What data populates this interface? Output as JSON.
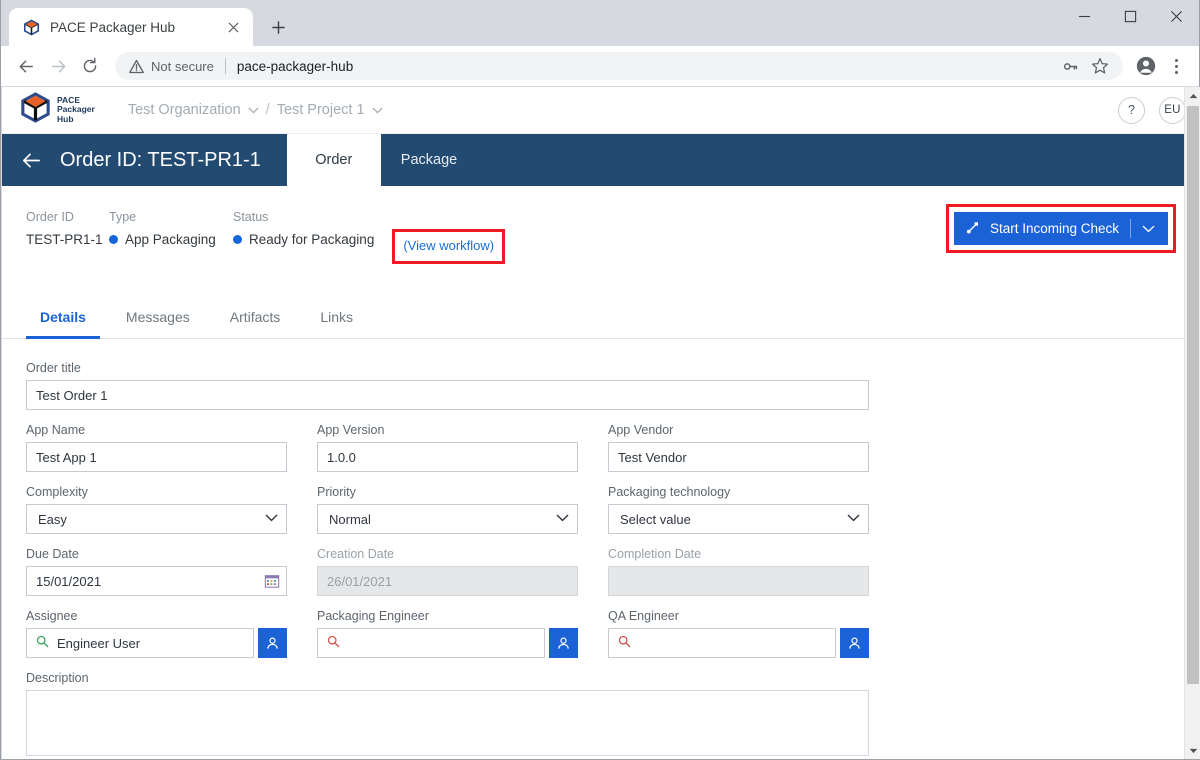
{
  "browser": {
    "tab": {
      "title": "PACE Packager Hub",
      "favicon_icon": "pace-cube-icon",
      "close_icon": "close-icon"
    },
    "new_tab_label": "+",
    "nav": {
      "back_icon": "back-arrow-icon",
      "forward_icon": "forward-arrow-icon",
      "reload_icon": "reload-icon"
    },
    "omnibox": {
      "security_icon": "not-secure-warning-icon",
      "security_label": "Not secure",
      "url": "pace-packager-hub",
      "key_icon": "password-key-icon",
      "star_icon": "bookmark-star-icon",
      "profile_icon": "profile-avatar-icon",
      "menu_icon": "kebab-menu-icon"
    },
    "window": {
      "minimize": "—",
      "maximize": "□",
      "close": "✕"
    }
  },
  "appbar": {
    "logo": {
      "icon": "pace-cube-logo-icon",
      "line1": "PACE",
      "line2": "Packager",
      "line3": "Hub"
    },
    "breadcrumbs": [
      {
        "label": "Test Organization",
        "caret": "⌄"
      },
      {
        "label": "Test Project 1",
        "caret": "⌄"
      }
    ],
    "separator": "/",
    "help_label": "?",
    "avatar_label": "EU"
  },
  "orderbar": {
    "back_icon": "back-arrow-icon",
    "title": "Order ID: TEST-PR1-1",
    "tabs": [
      {
        "label": "Order",
        "active": true
      },
      {
        "label": "Package",
        "active": false
      }
    ]
  },
  "meta": {
    "fields": [
      {
        "label": "Order ID",
        "value": "TEST-PR1-1",
        "has_dot": false
      },
      {
        "label": "Type",
        "value": "App Packaging",
        "has_dot": true
      },
      {
        "label": "Status",
        "value": "Ready for Packaging",
        "has_dot": true
      }
    ],
    "view_workflow_label": "(View workflow)",
    "dot_color": "#1565d8",
    "highlight_color": "#ee1b24"
  },
  "action": {
    "icon": "workflow-branch-icon",
    "label": "Start Incoming Check",
    "caret": "⌄",
    "color": "#1b62d6"
  },
  "subtabs": [
    {
      "label": "Details",
      "active": true
    },
    {
      "label": "Messages",
      "active": false
    },
    {
      "label": "Artifacts",
      "active": false
    },
    {
      "label": "Links",
      "active": false
    }
  ],
  "form": {
    "order_title": {
      "label": "Order title",
      "value": "Test Order 1"
    },
    "app_name": {
      "label": "App Name",
      "value": "Test App 1"
    },
    "app_version": {
      "label": "App Version",
      "value": "1.0.0"
    },
    "app_vendor": {
      "label": "App Vendor",
      "value": "Test Vendor"
    },
    "complexity": {
      "label": "Complexity",
      "value": "Easy"
    },
    "priority": {
      "label": "Priority",
      "value": "Normal"
    },
    "packaging_technology": {
      "label": "Packaging technology",
      "value": "Select value"
    },
    "due_date": {
      "label": "Due Date",
      "value": "15/01/2021",
      "icon": "calendar-icon"
    },
    "creation_date": {
      "label": "Creation Date",
      "value": "26/01/2021",
      "disabled": true
    },
    "completion_date": {
      "label": "Completion Date",
      "value": "",
      "disabled": true
    },
    "assignee": {
      "label": "Assignee",
      "value": "Engineer User",
      "search_icon": "search-icon",
      "picker_icon": "user-picker-icon"
    },
    "packaging_engineer": {
      "label": "Packaging Engineer",
      "value": "",
      "search_icon": "search-icon",
      "picker_icon": "user-picker-icon"
    },
    "qa_engineer": {
      "label": "QA Engineer",
      "value": "",
      "search_icon": "search-icon",
      "picker_icon": "user-picker-icon"
    },
    "description": {
      "label": "Description",
      "value": ""
    }
  },
  "scrollbar": {
    "up_arrow": "▲",
    "down_arrow": "▼"
  }
}
